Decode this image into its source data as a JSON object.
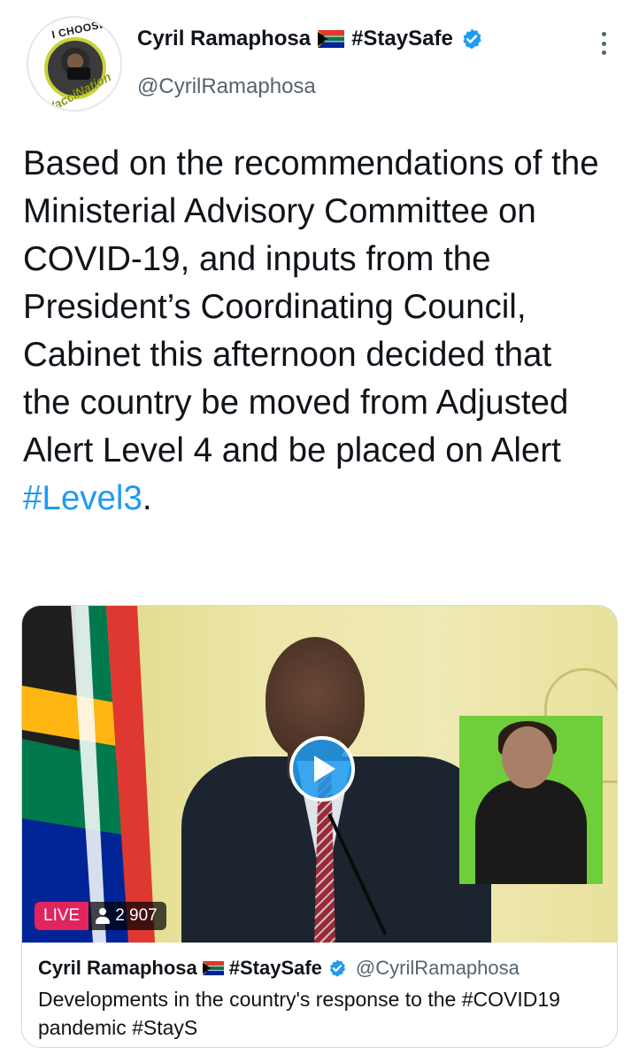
{
  "header": {
    "display_name": "Cyril Ramaphosa",
    "name_hashtag": "#StaySafe",
    "handle": "@CyrilRamaphosa",
    "avatar_ring_top": "I CHOOSE",
    "avatar_ring_bottom": "#VacciNation"
  },
  "tweet": {
    "text_main": "Based on the recommendations of the Ministerial Advisory Committee on COVID-19, and inputs from the President’s Coordinating Council, Cabinet this afternoon decided that the country be moved from Adjusted Alert Level 4 and be placed on Alert ",
    "hashtag": "#Level3",
    "text_end": "."
  },
  "media": {
    "live_label": "LIVE",
    "viewer_count": "2 907"
  },
  "card": {
    "display_name": "Cyril Ramaphosa",
    "name_hashtag": "#StaySafe",
    "handle": "@CyrilRamaphosa",
    "description": "Developments in the country's response to the #COVID19 pandemic #StayS"
  },
  "icons": {
    "verified": "verified-badge-icon",
    "flag": "south-africa-flag-icon",
    "more": "more-options-icon",
    "play": "play-icon",
    "viewers": "person-icon"
  },
  "colors": {
    "accent": "#1d9bf0",
    "live": "#e0245e",
    "text": "#0f1419",
    "secondary": "#536471"
  }
}
